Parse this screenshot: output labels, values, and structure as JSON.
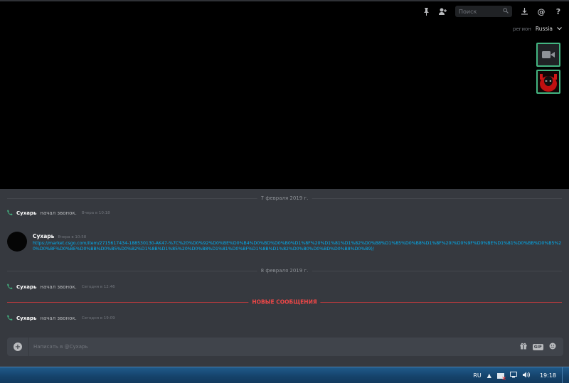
{
  "toolbar": {
    "pin_icon": "pin-icon",
    "add_user_icon": "add-user-icon",
    "search_placeholder": "Поиск",
    "download_icon": "download-icon",
    "mentions_icon": "at-icon",
    "help_icon": "help-icon"
  },
  "call": {
    "region_label": "регион",
    "region_value": "Russia"
  },
  "chat": {
    "divider1": "7 февраля 2019 г.",
    "divider2": "8 февраля 2019 г.",
    "new_messages": "НОВЫЕ СООБЩЕНИЯ",
    "sys1": {
      "who": "Сухарь",
      "action": "начал звонок.",
      "time": "Вчера в 10:18"
    },
    "message": {
      "author": "Сухарь",
      "time": "Вчера в 10:58",
      "link": "https://market.csgo.com/item/2715617434-188530130-AK47-%7C%20%D0%92%D0%BE%D0%B4%D0%BD%D0%B0%D1%8F%20%D1%81%D1%82%D0%B8%D1%85%D0%B8%D1%8F%20(%D0%9F%D0%BE%D1%81%D0%BB%D0%B5%20%D0%BF%D0%BE%D0%BB%D0%B5%D0%B2%D1%8B%D1%85%20%D0%B8%D1%81%D0%BF%D1%8B%D1%82%D0%B0%D0%BD%D0%B8%D0%B9)/"
    },
    "sys2": {
      "who": "Сухарь",
      "action": "начал звонок.",
      "time": "Сегодня в 12:46"
    },
    "sys3": {
      "who": "Сухарь",
      "action": "начал звонок.",
      "time": "Сегодня в 19:09"
    }
  },
  "composer": {
    "placeholder": "Написать в @Сухарь",
    "gift_icon": "gift-icon",
    "gif_label": "GIF",
    "emoji_icon": "emoji-icon"
  },
  "taskbar": {
    "language": "RU",
    "clock": "19:18"
  }
}
